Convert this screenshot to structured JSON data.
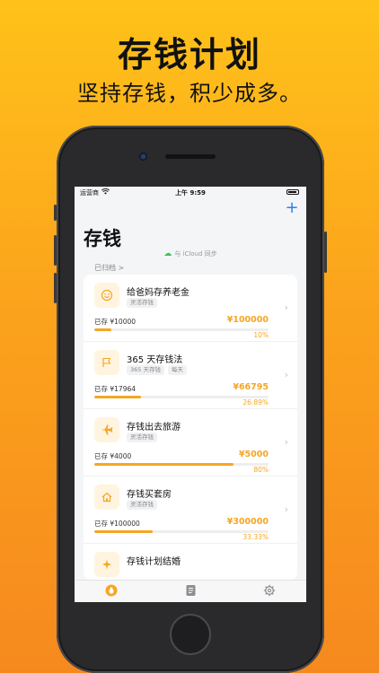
{
  "headline": "存钱计划",
  "subline": "坚持存钱，积少成多。",
  "status": {
    "carrier": "运营商",
    "time": "上午 9:59"
  },
  "header": {
    "title": "存钱",
    "add": "+"
  },
  "sync_text": "与 iCloud 同步",
  "archived_label": "已归档 >",
  "plans": [
    {
      "name": "给爸妈存养老金",
      "tags": [
        "灵活存钱"
      ],
      "saved": "已存 ¥10000",
      "target": "¥100000",
      "percent_text": "10%",
      "progress": 0.1,
      "icon": "smile-icon"
    },
    {
      "name": "365 天存钱法",
      "tags": [
        "365 天存钱",
        "每天"
      ],
      "saved": "已存 ¥17964",
      "target": "¥66795",
      "percent_text": "26.89%",
      "progress": 0.2689,
      "icon": "flag-icon"
    },
    {
      "name": "存钱出去旅游",
      "tags": [
        "灵活存钱"
      ],
      "saved": "已存 ¥4000",
      "target": "¥5000",
      "percent_text": "80%",
      "progress": 0.8,
      "icon": "airplane-icon"
    },
    {
      "name": "存钱买套房",
      "tags": [
        "灵活存钱"
      ],
      "saved": "已存 ¥100000",
      "target": "¥300000",
      "percent_text": "33.33%",
      "progress": 0.3333,
      "icon": "house-icon"
    },
    {
      "name": "存钱计划结婚",
      "tags": [],
      "saved": "",
      "target": "",
      "percent_text": "",
      "progress": 0,
      "icon": "sparkle-icon"
    }
  ],
  "tabs": [
    {
      "name": "savings",
      "icon": "drop-icon",
      "active": true
    },
    {
      "name": "records",
      "icon": "notebook-icon",
      "active": false
    },
    {
      "name": "settings",
      "icon": "gear-icon",
      "active": false
    }
  ],
  "colors": {
    "accent": "#f5a623",
    "link": "#2f7ef7",
    "background_top": "#ffc21a",
    "background_bottom": "#f6891e"
  }
}
